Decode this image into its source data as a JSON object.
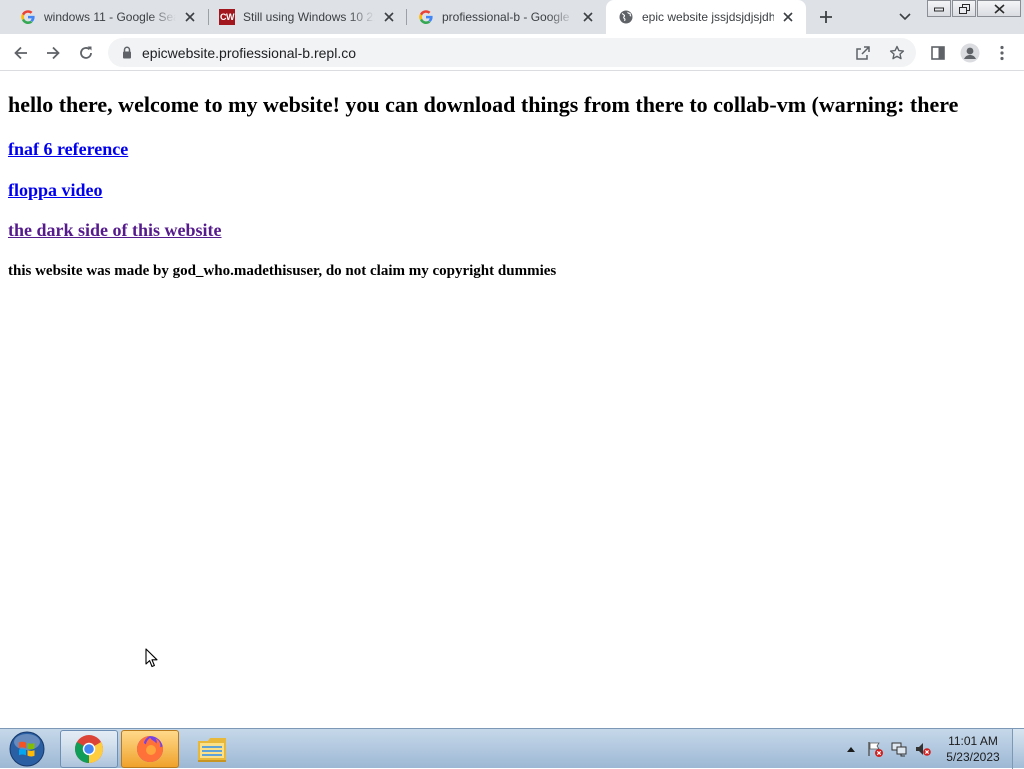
{
  "browser": {
    "tabs": [
      {
        "title": "windows 11 - Google Sea",
        "favicon": "google-g-icon",
        "active": false
      },
      {
        "title": "Still using Windows 10 21",
        "favicon": "cw-logo-icon",
        "favicon_text": "CW",
        "active": false
      },
      {
        "title": "profiessional-b - Google",
        "favicon": "google-g-icon",
        "active": false
      },
      {
        "title": "epic website jssjdsjdjsjdh",
        "favicon": "globe-icon",
        "active": true
      }
    ],
    "url": "epicwebsite.profiessional-b.repl.co"
  },
  "page": {
    "heading": "hello there, welcome to my website! you can download things from there to collab-vm (warning: there",
    "links": [
      {
        "label": "fnaf 6 reference",
        "visited": false
      },
      {
        "label": "floppa video",
        "visited": false
      },
      {
        "label": "the dark side of this website",
        "visited": true
      }
    ],
    "credit": "this website was made by god_who.madethisuser, do not claim my copyright dummies"
  },
  "taskbar": {
    "pinned_apps": [
      "chrome-icon",
      "firefox-icon",
      "file-explorer-icon"
    ],
    "active_app": "firefox-icon",
    "tray_icons": [
      "show-hidden-icons-icon",
      "action-center-flag-icon",
      "network-icon",
      "volume-muted-icon"
    ],
    "clock": {
      "time": "11:01 AM",
      "date": "5/23/2023"
    }
  },
  "colors": {
    "tabstrip_bg": "#dee1e6",
    "link_unvisited": "#0000ee",
    "link_visited": "#551a8b"
  }
}
